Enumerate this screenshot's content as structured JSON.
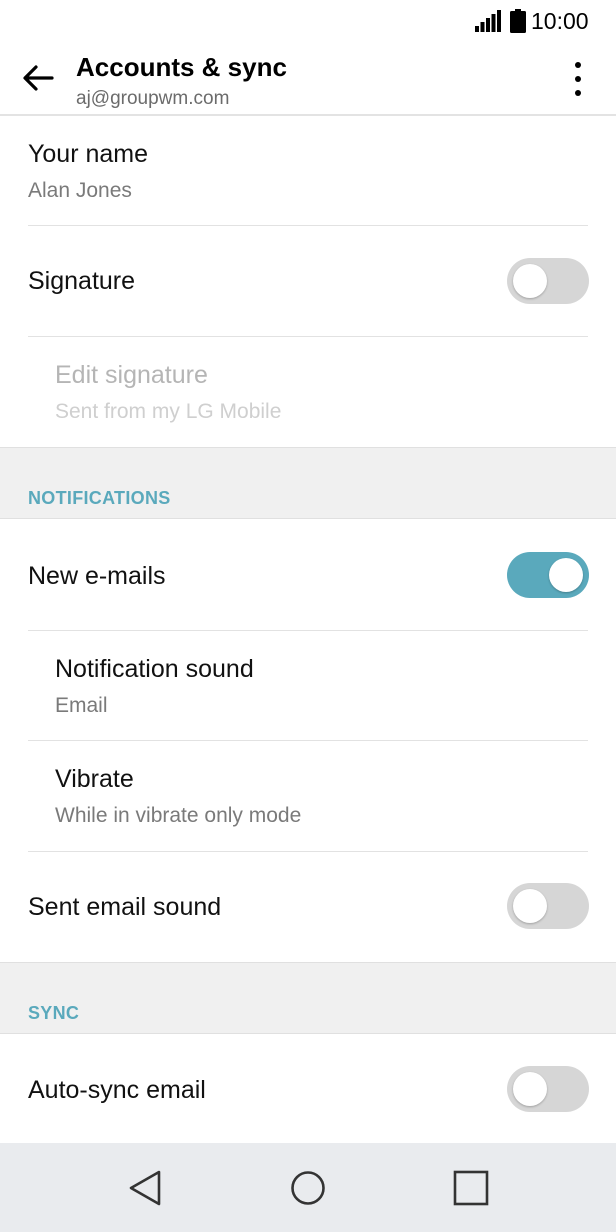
{
  "status_bar": {
    "time": "10:00"
  },
  "app_bar": {
    "title": "Accounts & sync",
    "account": "aj@groupwm.com"
  },
  "rows": {
    "your_name": {
      "label": "Your name",
      "value": "Alan Jones"
    },
    "signature": {
      "label": "Signature",
      "enabled": false
    },
    "edit_signature": {
      "label": "Edit signature",
      "value": "Sent from my LG Mobile"
    },
    "new_emails": {
      "label": "New e-mails",
      "enabled": true
    },
    "notification_sound": {
      "label": "Notification sound",
      "value": "Email"
    },
    "vibrate": {
      "label": "Vibrate",
      "value": "While in vibrate only mode"
    },
    "sent_email_sound": {
      "label": "Sent email sound",
      "enabled": false
    },
    "auto_sync": {
      "label": "Auto-sync email",
      "enabled": false
    }
  },
  "sections": {
    "notifications": "NOTIFICATIONS",
    "sync": "SYNC"
  },
  "colors": {
    "accent": "#5aa9bc",
    "toggle_off": "#d6d6d6",
    "section_bg": "#f0f0f0",
    "nav_bg": "#e9ebee"
  }
}
